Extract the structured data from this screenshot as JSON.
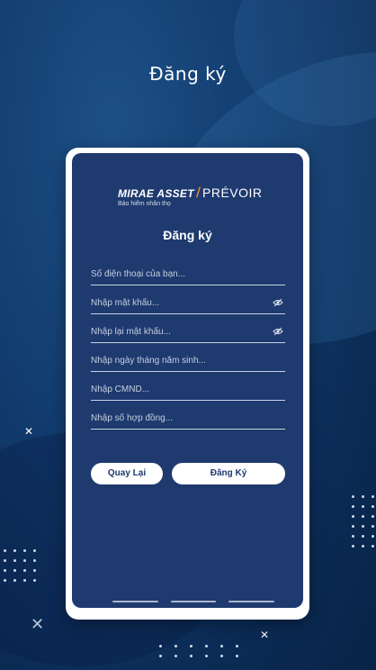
{
  "screen_title": "Đăng ký",
  "logo": {
    "brand_left": "MIRAE ASSET",
    "brand_right": "PRÉVOIR",
    "tagline": "Bảo hiểm nhân thọ"
  },
  "form": {
    "title": "Đăng ký",
    "fields": [
      {
        "placeholder": "Số điện thoại của bạn...",
        "icon": ""
      },
      {
        "placeholder": "Nhập mật khẩu...",
        "icon": "eye-off-icon"
      },
      {
        "placeholder": "Nhập lại mật khẩu...",
        "icon": "eye-off-icon"
      },
      {
        "placeholder": "Nhập ngày tháng năm sinh...",
        "icon": ""
      },
      {
        "placeholder": "Nhập CMND...",
        "icon": ""
      },
      {
        "placeholder": "Nhập số hợp đồng...",
        "icon": ""
      }
    ],
    "back_label": "Quay Lại",
    "register_label": "Đăng Ký"
  },
  "decor": {
    "x_mark": "✕"
  },
  "colors": {
    "background": "#123d70",
    "card": "#1e3a6f",
    "frame": "#ffffff",
    "accent": "#f08a24"
  }
}
